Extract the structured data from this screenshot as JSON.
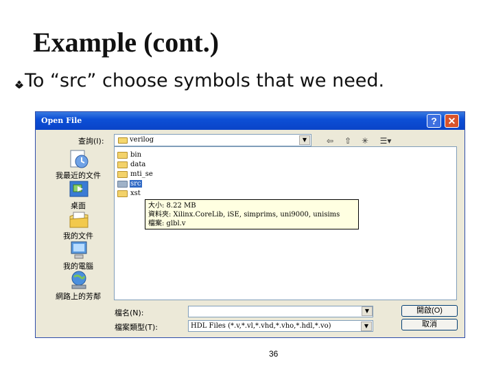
{
  "slide": {
    "title": "Example (cont.)",
    "bullet": "To “src” choose symbols that we need.",
    "page_number": "36"
  },
  "dialog": {
    "title": "Open File",
    "help_label": "?",
    "close_label": "✕",
    "look_in_label": "查詢(I):",
    "look_in_value": "verilog",
    "places": [
      {
        "label": "我最近的文件",
        "icon": "recent-icon"
      },
      {
        "label": "桌面",
        "icon": "desktop-icon"
      },
      {
        "label": "我的文件",
        "icon": "documents-icon"
      },
      {
        "label": "我的電腦",
        "icon": "computer-icon"
      },
      {
        "label": "網路上的芳鄰",
        "icon": "network-icon"
      }
    ],
    "items": [
      {
        "name": "bin",
        "selected": false
      },
      {
        "name": "data",
        "selected": false
      },
      {
        "name": "mti_se",
        "selected": false
      },
      {
        "name": "src",
        "selected": true
      },
      {
        "name": "xst",
        "selected": false
      }
    ],
    "tooltip": {
      "line1": "大小: 8.22 MB",
      "line2": "資料夾: Xilinx.CoreLib, iSE, simprims, uni9000, unisims",
      "line3": "檔案: glbl.v"
    },
    "filename_label": "檔名(N):",
    "filename_value": "",
    "filetype_label": "檔案類型(T):",
    "filetype_value": "HDL Files (*.v,*.vl,*.vhd,*.vho,*.hdl,*.vo)",
    "open_label": "開啟(O)",
    "cancel_label": "取消"
  }
}
